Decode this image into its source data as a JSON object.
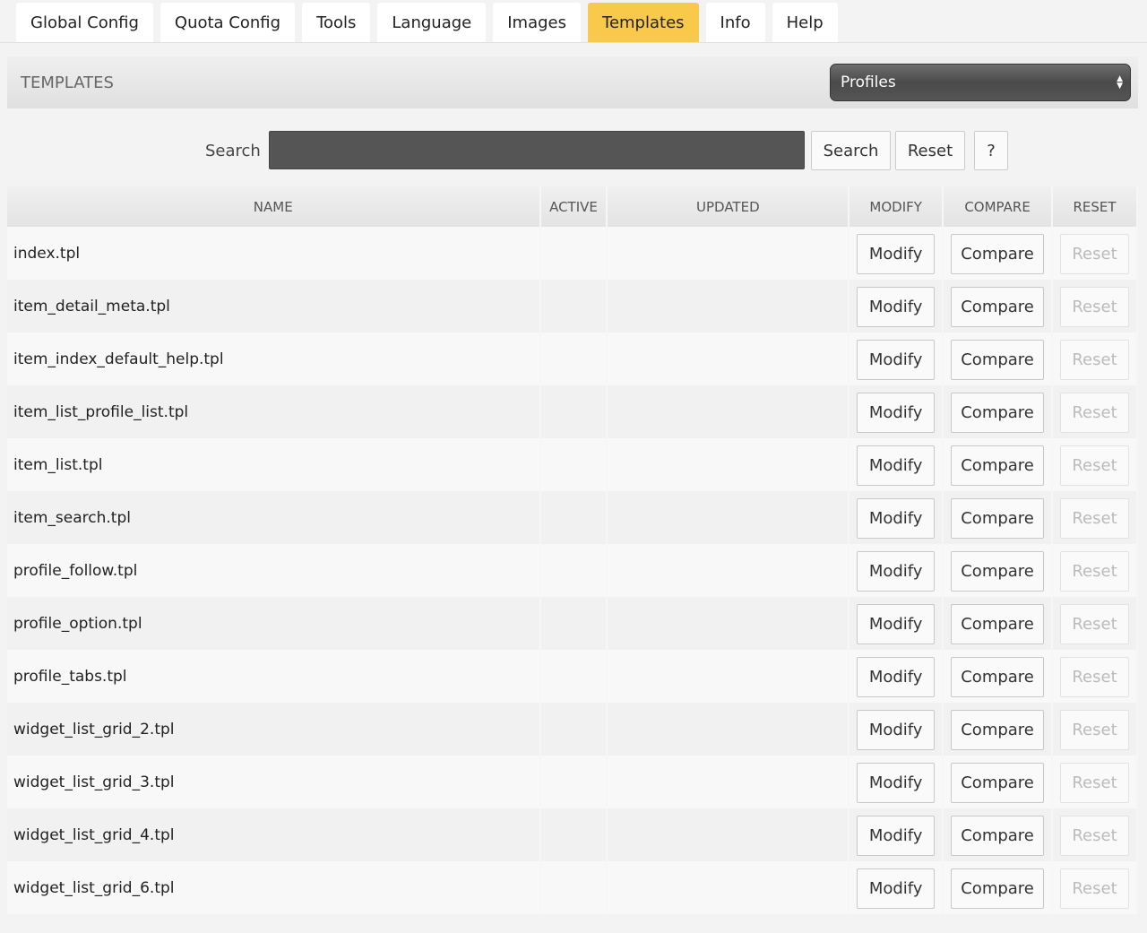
{
  "tabs": [
    "Global Config",
    "Quota Config",
    "Tools",
    "Language",
    "Images",
    "Templates",
    "Info",
    "Help"
  ],
  "active_tab": "Templates",
  "header": {
    "title": "TEMPLATES",
    "select_value": "Profiles"
  },
  "search": {
    "label": "Search",
    "value": "",
    "search_button": "Search",
    "reset_button": "Reset",
    "help_button": "?"
  },
  "table": {
    "columns": [
      "NAME",
      "ACTIVE",
      "UPDATED",
      "MODIFY",
      "COMPARE",
      "RESET"
    ],
    "row_buttons": {
      "modify": "Modify",
      "compare": "Compare",
      "reset": "Reset"
    },
    "rows": [
      {
        "name": "index.tpl",
        "active": "",
        "updated": ""
      },
      {
        "name": "item_detail_meta.tpl",
        "active": "",
        "updated": ""
      },
      {
        "name": "item_index_default_help.tpl",
        "active": "",
        "updated": ""
      },
      {
        "name": "item_list_profile_list.tpl",
        "active": "",
        "updated": ""
      },
      {
        "name": "item_list.tpl",
        "active": "",
        "updated": ""
      },
      {
        "name": "item_search.tpl",
        "active": "",
        "updated": ""
      },
      {
        "name": "profile_follow.tpl",
        "active": "",
        "updated": ""
      },
      {
        "name": "profile_option.tpl",
        "active": "",
        "updated": ""
      },
      {
        "name": "profile_tabs.tpl",
        "active": "",
        "updated": ""
      },
      {
        "name": "widget_list_grid_2.tpl",
        "active": "",
        "updated": ""
      },
      {
        "name": "widget_list_grid_3.tpl",
        "active": "",
        "updated": ""
      },
      {
        "name": "widget_list_grid_4.tpl",
        "active": "",
        "updated": ""
      },
      {
        "name": "widget_list_grid_6.tpl",
        "active": "",
        "updated": ""
      }
    ]
  },
  "colors": {
    "active_tab": "#f9c94b"
  }
}
